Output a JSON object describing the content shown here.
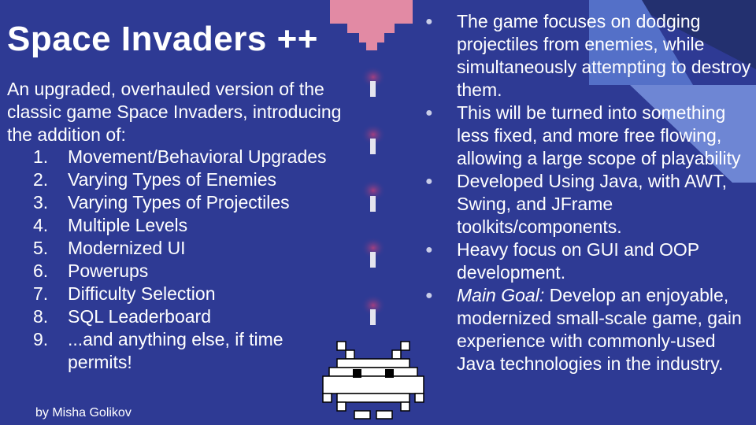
{
  "slide": {
    "title": "Space Invaders ++",
    "intro": "An upgraded, overhauled version of the classic game Space Invaders, introducing the addition of:",
    "features": [
      {
        "num": "1.",
        "text": "Movement/Behavioral Upgrades"
      },
      {
        "num": "2.",
        "text": "Varying Types of Enemies"
      },
      {
        "num": "3.",
        "text": "Varying Types of Projectiles"
      },
      {
        "num": "4.",
        "text": "Multiple Levels"
      },
      {
        "num": "5.",
        "text": "Modernized UI"
      },
      {
        "num": "6.",
        "text": "Powerups"
      },
      {
        "num": "7.",
        "text": "Difficulty Selection"
      },
      {
        "num": "8.",
        "text": "SQL Leaderboard"
      },
      {
        "num": "9.",
        "text": "...and anything else, if time permits!"
      }
    ],
    "author": "by Misha Golikov",
    "bullets": [
      {
        "text": "The game focuses on dodging projectiles from enemies, while simultaneously attempting to destroy them."
      },
      {
        "text": "This will be turned into something less fixed, and more free flowing, allowing a large scope of playability"
      },
      {
        "text": "Developed Using Java, with AWT, Swing, and JFrame toolkits/components."
      },
      {
        "text": "Heavy focus on GUI and OOP development."
      },
      {
        "emphasis": "Main Goal:",
        "text": " Develop an enjoyable, modernized small-scale game, gain experience with commonly-used Java technologies in the industry."
      }
    ]
  },
  "colors": {
    "background": "#2e3a94",
    "text": "#ffffff",
    "ship": "#e28aa4",
    "projectile_glow": "#9b3a7a",
    "invader": "#ffffff",
    "accent_light": "#6e86d4",
    "accent_dark": "#23306f"
  },
  "icons": {
    "ship": "player-ship-icon",
    "projectile": "laser-projectile-icon",
    "invader": "space-invader-alien-icon"
  }
}
